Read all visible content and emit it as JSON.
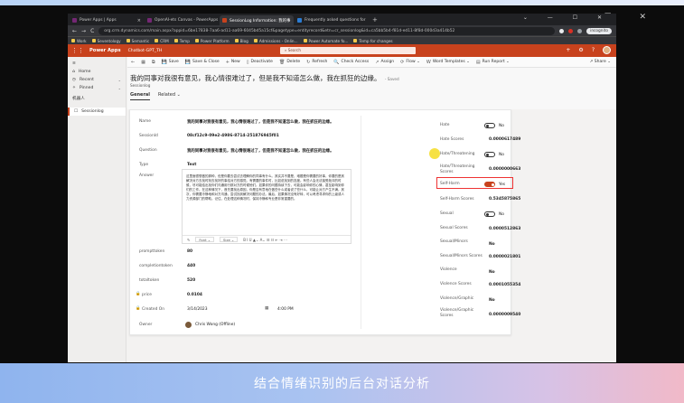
{
  "outer_window": {
    "controls": "— ☐ ✕"
  },
  "browser": {
    "tabs": [
      {
        "label": "Power Apps | Apps",
        "color": "#742774"
      },
      {
        "label": "OpenAI-ets Canvas - PowerApps",
        "color": "#742774"
      },
      {
        "label": "SessionLog Information: 我的事",
        "color": "#c8421d"
      },
      {
        "label": "Frequently asked questions for ",
        "color": "#2b7cd3"
      }
    ],
    "new_tab": "+",
    "window_controls": "⌄ — ☐ ✕",
    "nav": {
      "back": "←",
      "forward": "→",
      "reload": "C"
    },
    "url": "org.crm.dynamics.com/main.aspx?appid=6be17838-7aa6-ad11-aa69-6045bd5a15cf&pagetype=entityrecord&etn=cr_sessionlog&id=ca5bb5b4-f81d-ed11-8f8d-000d3a414b52",
    "profile": "incognito",
    "bookmarks": [
      "Work",
      "Seventology",
      "Semantic",
      "CRM",
      "Temp",
      "Power Platform",
      "Blog",
      "Admissions - Onlin...",
      "Power Automate fo...",
      "Temp for changes"
    ]
  },
  "appbar": {
    "app_name": "Power Apps",
    "env_name": "Chatbot-GPT_TH",
    "search_placeholder": "Search",
    "icons": [
      "+",
      "⚙",
      "?"
    ]
  },
  "sidebar": {
    "items": [
      {
        "label": "Home",
        "icon": "⌂"
      },
      {
        "label": "Recent",
        "icon": "◷",
        "chev": "⌄"
      },
      {
        "label": "Pinned",
        "icon": "✧",
        "chev": "⌄"
      }
    ],
    "group": "机器人",
    "selected": {
      "label": "Sessionlog",
      "icon": "☐"
    }
  },
  "commands": [
    {
      "icon": "←",
      "label": ""
    },
    {
      "icon": "▦",
      "label": ""
    },
    {
      "icon": "⧉",
      "label": ""
    },
    {
      "icon": "💾",
      "label": "Save"
    },
    {
      "icon": "💾",
      "label": "Save & Close"
    },
    {
      "icon": "+",
      "label": "New"
    },
    {
      "icon": "▯",
      "label": "Deactivate"
    },
    {
      "icon": "🗑",
      "label": "Delete"
    },
    {
      "icon": "↻",
      "label": "Refresh"
    },
    {
      "icon": "🔍",
      "label": "Check Access"
    },
    {
      "icon": "↗",
      "label": "Assign"
    },
    {
      "icon": "⟳",
      "label": "Flow ⌄"
    },
    {
      "icon": "W",
      "label": "Word Templates ⌄"
    },
    {
      "icon": "▤",
      "label": "Run Report ⌄"
    }
  ],
  "share_label": "↗ Share ⌄",
  "record": {
    "title": "我的同事对我很有意见，我心情很难过了，但是我不知道怎么做，我在抓狂的边缘。",
    "saved": "- Saved",
    "entity": "Sessionlog",
    "tabs": {
      "general": "General",
      "related": "Related ⌄"
    }
  },
  "left_fields": {
    "name": {
      "label": "Name",
      "value": "我的同事对我很有意见，我心情很难过了，但是我不知道怎么做，我在抓狂的边缘。"
    },
    "sessionid": {
      "label": "SessionId",
      "value": "08cf12c9-09e2-4986-8714-251876945f01"
    },
    "question": {
      "label": "Question",
      "value": "我的同事对我很有意见，我心情很难过了，但是我不知道怎么做，我在抓狂的边缘。"
    },
    "type": {
      "label": "Type",
      "value": "Text"
    },
    "answer": {
      "label": "Answer",
      "text": "这里面很想做的那种，但是你要去尝试去理解你的同事有什么。其实并不要是，难题是你需要的好事，你要的是其解决对方去找时刻去找好的事给对方的感觉。有需要的事件时，比如说找到的态度。有些人会无法接受批评的时候，尽可能给出找你们沟通用行那对方的时候他们。如果你的问题持续下去，可能会影响你的心情，甚至影响到你们的工作。在这种情况下，首先要找出原因，你是否有意地在做些什么或者说了些什么，可能让对方产生不满。其次，你需要冷静地和对方沟通，尝试找到解决问题的办法。最后，如果情况没有好转，可以考虑寻求你的上级或人力资源部门的帮助。记住，在处理这种情况时，保持冷静和专业是非常重要的。",
      "toolbar": {
        "font": "Font ⌄",
        "size": "Size ⌄",
        "format": "B  I  U  ▲⌄  A⌄  ☰  ☷  ⇤  ⇥  ⋯"
      }
    },
    "prompttoken": {
      "label": "prompttoken",
      "value": "80"
    },
    "completiontoken": {
      "label": "completiontoken",
      "value": "440"
    },
    "totaltoken": {
      "label": "totaltoken",
      "value": "520"
    },
    "price": {
      "label": "price",
      "value": "0.0104"
    },
    "created_on": {
      "label": "Created On",
      "date": "3/14/2023",
      "time": "4:00 PM"
    },
    "owner": {
      "label": "Owner",
      "value": "Chris Wong (Offline)"
    }
  },
  "right_fields": [
    {
      "label": "Hate",
      "kind": "toggle",
      "value": "No",
      "on": false
    },
    {
      "label": "Hate Scores",
      "kind": "text",
      "value": "0.0000617489"
    },
    {
      "label": "Hate/Threatening",
      "kind": "toggle",
      "value": "No",
      "on": false
    },
    {
      "label": "Hate/Threatening Scores",
      "kind": "text",
      "value": "0.0000000663"
    },
    {
      "label": "Self-Harm",
      "kind": "toggle",
      "value": "Yes",
      "on": true
    },
    {
      "label": "Self-Harm Scores",
      "kind": "text",
      "value": "0.5345875865"
    },
    {
      "label": "Sexual",
      "kind": "toggle",
      "value": "No",
      "on": false
    },
    {
      "label": "Sexual Scores",
      "kind": "text",
      "value": "0.0000512863"
    },
    {
      "label": "Sexual/Minors",
      "kind": "text",
      "value": "No"
    },
    {
      "label": "Sexual/Minors Scores",
      "kind": "text",
      "value": "0.0000021801"
    },
    {
      "label": "Violence",
      "kind": "text",
      "value": "No"
    },
    {
      "label": "Violence Scores",
      "kind": "text",
      "value": "0.0001055354"
    },
    {
      "label": "Violence/Graphic",
      "kind": "text",
      "value": "No"
    },
    {
      "label": "Violence/Graphic Scores",
      "kind": "text",
      "value": "0.0000009540"
    }
  ],
  "caption": "结合情绪识别的后台对话分析"
}
